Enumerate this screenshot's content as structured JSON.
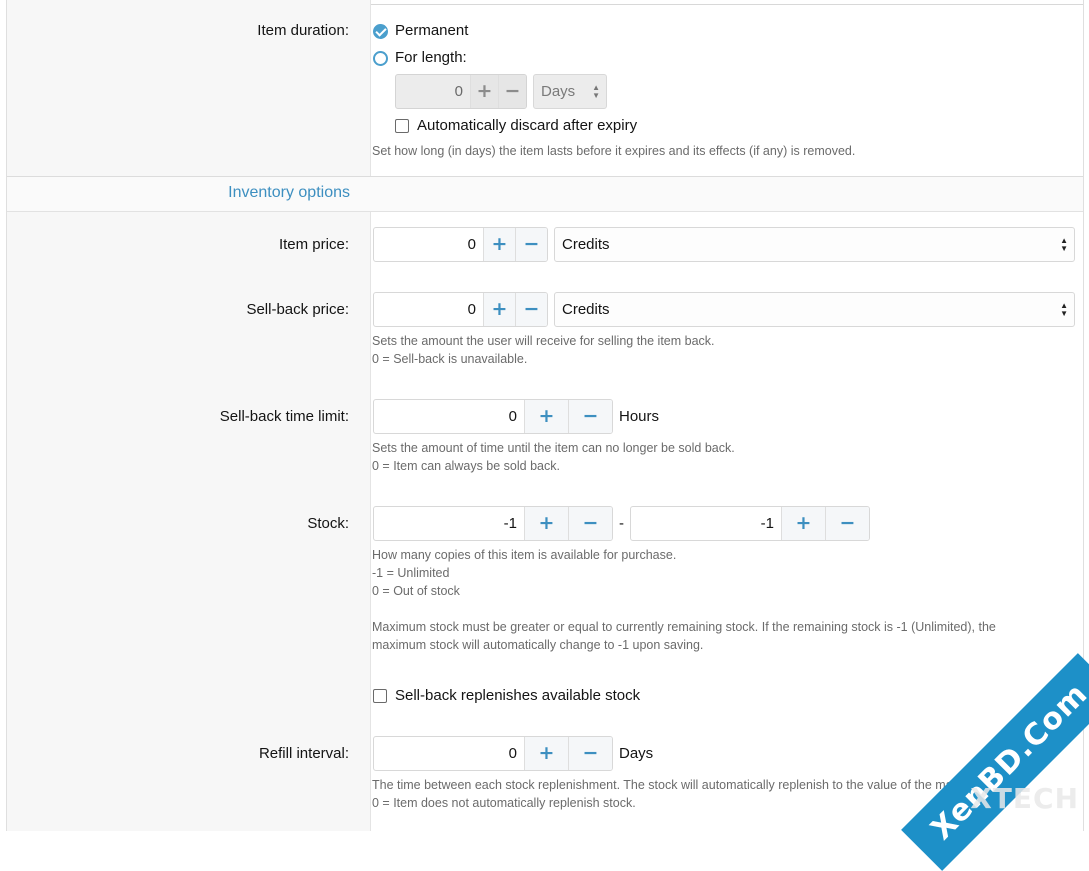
{
  "duration": {
    "label": "Item duration:",
    "permanent_label": "Permanent",
    "length_label": "For length:",
    "length_value": "0",
    "unit_value": "Days",
    "discard_label": "Automatically discard after expiry",
    "hint": "Set how long (in days) the item lasts before it expires and its effects (if any) is removed."
  },
  "inventory": {
    "section_title": "Inventory options",
    "item_price": {
      "label": "Item price:",
      "value": "0",
      "currency": "Credits"
    },
    "sellback_price": {
      "label": "Sell-back price:",
      "value": "0",
      "currency": "Credits",
      "hint1": "Sets the amount the user will receive for selling the item back.",
      "hint2": "0 = Sell-back is unavailable."
    },
    "sellback_time": {
      "label": "Sell-back time limit:",
      "value": "0",
      "suffix": "Hours",
      "hint1": "Sets the amount of time until the item can no longer be sold back.",
      "hint2": "0 = Item can always be sold back."
    },
    "stock": {
      "label": "Stock:",
      "value_min": "-1",
      "separator": "-",
      "value_max": "-1",
      "hint1": "How many copies of this item is available for purchase.",
      "hint2": "-1 = Unlimited",
      "hint3": "0 = Out of stock",
      "hint4": "Maximum stock must be greater or equal to currently remaining stock. If the remaining stock is -1 (Unlimited), the",
      "hint5": "maximum stock will automatically change to -1 upon saving."
    },
    "sellback_replenish_label": "Sell-back replenishes available stock",
    "refill": {
      "label": "Refill interval:",
      "value": "0",
      "suffix": "Days",
      "hint1": "The time between each stock replenishment. The stock will automatically replenish to the value of the maximum stock.",
      "hint2": "0 = Item does not automatically replenish stock."
    }
  },
  "icons": {
    "plus": "+",
    "minus": "−",
    "select_arrows": [
      "▲",
      "▼"
    ]
  },
  "watermark": {
    "text": "XenBD.Com",
    "sub": "XTECH"
  },
  "colors": {
    "accent": "#3d8fc0",
    "watermark": "#1d90c8"
  }
}
